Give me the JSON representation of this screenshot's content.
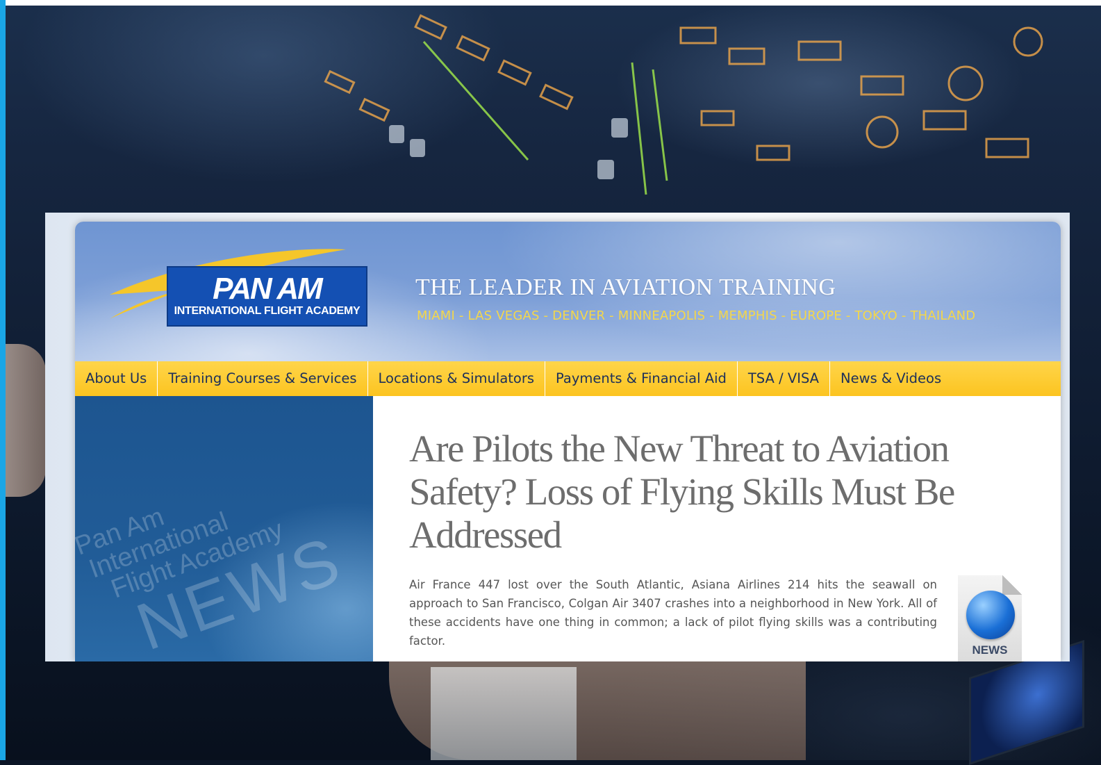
{
  "colors": {
    "accent_blue": "#1aa6e6",
    "header_blue": "#7d9fd7",
    "nav_yellow": "#fcc420",
    "location_gold": "#f4d74a",
    "logo_blue": "#1450b3",
    "sidebar_blue": "#215c97",
    "headline_gray": "#6d6d6d"
  },
  "logo": {
    "main": "PAN AM",
    "sub": "INTERNATIONAL FLIGHT ACADEMY"
  },
  "header": {
    "tagline": "THE LEADER IN AVIATION TRAINING",
    "locations": "MIAMI - LAS VEGAS - DENVER - MINNEAPOLIS - MEMPHIS - EUROPE - TOKYO - THAILAND"
  },
  "nav": {
    "items": [
      "About Us",
      "Training Courses & Services",
      "Locations & Simulators",
      "Payments & Financial Aid",
      "TSA / VISA",
      "News & Videos"
    ]
  },
  "sidebar": {
    "watermark_lines": [
      "Pan Am",
      "International",
      "Flight Academy"
    ],
    "watermark_news": "NEWS"
  },
  "article": {
    "headline": "Are Pilots the New Threat to Aviation Safety? Loss of Flying Skills Must Be Addressed",
    "excerpt": "Air France 447 lost over the South Atlantic, Asiana Airlines 214 hits the seawall on approach to San Francisco, Colgan Air 3407 crashes into a neighborhood in New York. All of these accidents have one thing in common; a lack of pilot flying skills was a contributing factor.",
    "icon_label": "NEWS",
    "icon_name": "news-globe-icon"
  }
}
